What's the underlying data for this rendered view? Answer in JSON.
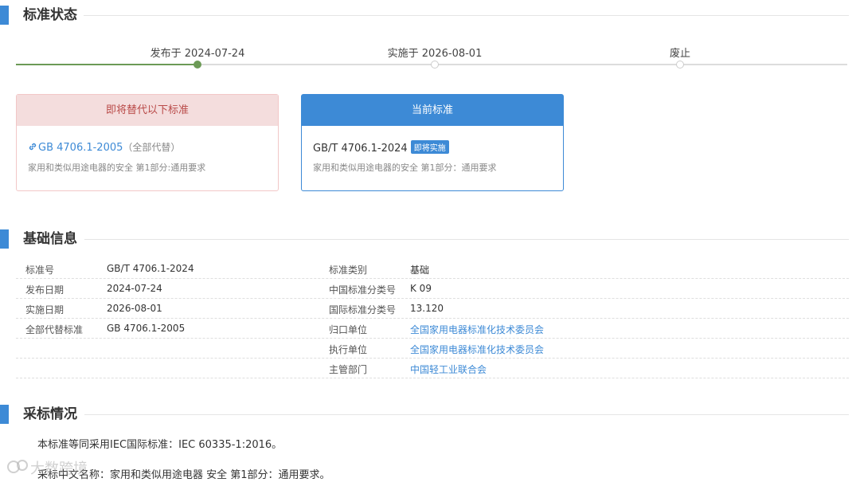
{
  "sections": {
    "status_title": "标准状态",
    "basic_title": "基础信息",
    "adoption_title": "采标情况"
  },
  "timeline": {
    "published": "发布于 2024-07-24",
    "implemented": "实施于 2026-08-01",
    "abolished": "废止"
  },
  "replace_card": {
    "header": "即将替代以下标准",
    "code": "GB 4706.1-2005",
    "note": "（全部代替）",
    "desc": "家用和类似用途电器的安全 第1部分:通用要求"
  },
  "current_card": {
    "header": "当前标准",
    "code": "GB/T 4706.1-2024",
    "badge": "即将实施",
    "desc": "家用和类似用途电器的安全 第1部分：通用要求"
  },
  "basic_info": {
    "rows": [
      {
        "k1": "标准号",
        "v1": "GB/T 4706.1-2024",
        "k2": "标准类别",
        "v2": "基础"
      },
      {
        "k1": "发布日期",
        "v1": "2024-07-24",
        "k2": "中国标准分类号",
        "v2": "K 09"
      },
      {
        "k1": "实施日期",
        "v1": "2026-08-01",
        "k2": "国际标准分类号",
        "v2": "13.120"
      },
      {
        "k1": "全部代替标准",
        "v1": "GB 4706.1-2005",
        "k2": "归口单位",
        "v2": "全国家用电器标准化技术委员会"
      },
      {
        "k1": "",
        "v1": "",
        "k2": "执行单位",
        "v2": "全国家用电器标准化技术委员会"
      },
      {
        "k1": "",
        "v1": "",
        "k2": "主管部门",
        "v2": "中国轻工业联合会"
      }
    ]
  },
  "adoption": {
    "line1": "本标准等同采用IEC国际标准：IEC 60335-1:2016。",
    "line2": "采标中文名称：家用和类似用途电器 安全 第1部分：通用要求。"
  },
  "watermark": "大数跨境",
  "colors": {
    "accent": "#3d8ad6",
    "timeline_active": "#6c9a56",
    "replace_header_bg": "#f4dddd",
    "replace_header_text": "#b94a48"
  },
  "icons": {
    "section_marker": "bar",
    "link": "chain-link-icon"
  }
}
